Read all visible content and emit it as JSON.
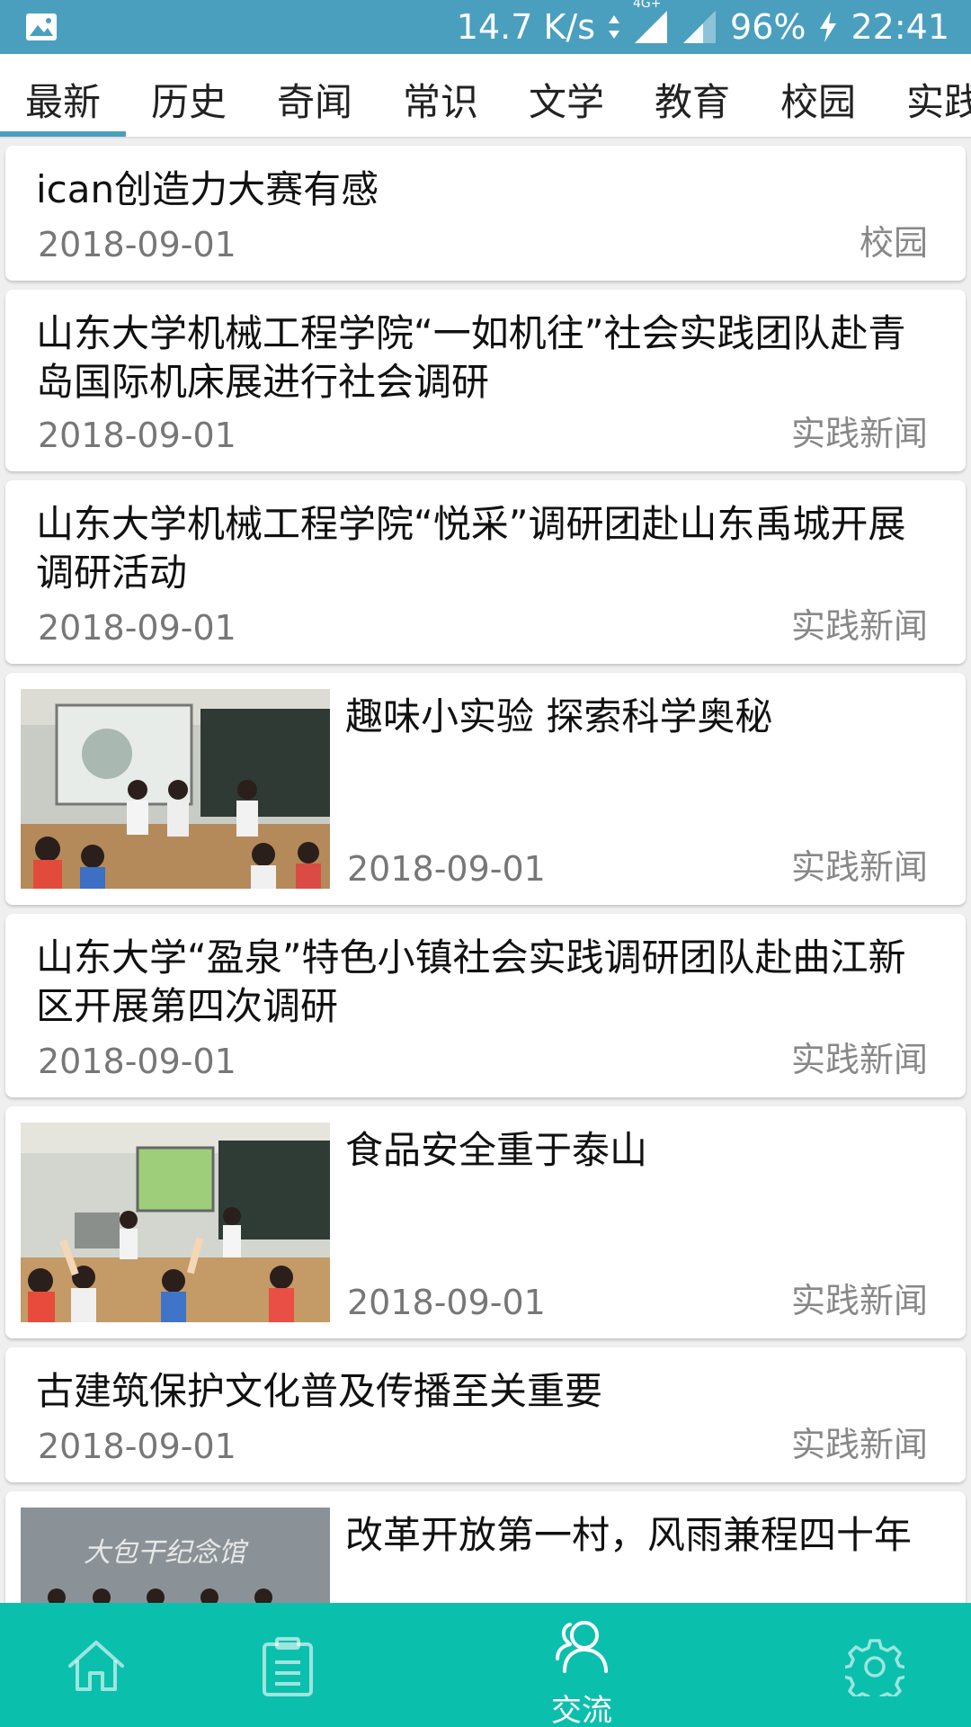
{
  "status_bar": {
    "speed": "14.7 K/s",
    "network_type": "4G+",
    "battery": "96%",
    "time": "22:41",
    "icons": [
      "image-icon",
      "data-arrows-icon",
      "signal-icon",
      "signal-icon-2",
      "charging-bolt-icon"
    ]
  },
  "tabs": [
    "最新",
    "历史",
    "奇闻",
    "常识",
    "文学",
    "教育",
    "校园",
    "实践"
  ],
  "active_tab_index": 0,
  "news": [
    {
      "title": "ican创造力大赛有感",
      "date": "2018-09-01",
      "category": "校园",
      "has_image": false
    },
    {
      "title": "山东大学机械工程学院“一如机往”社会实践团队赴青岛国际机床展进行社会调研",
      "date": "2018-09-01",
      "category": "实践新闻",
      "has_image": false
    },
    {
      "title": "山东大学机械工程学院“悦采”调研团赴山东禹城开展调研活动",
      "date": "2018-09-01",
      "category": "实践新闻",
      "has_image": false
    },
    {
      "title": "趣味小实验 探索科学奥秘",
      "date": "2018-09-01",
      "category": "实践新闻",
      "has_image": true
    },
    {
      "title": "山东大学“盈泉”特色小镇社会实践调研团队赴曲江新区开展第四次调研",
      "date": "2018-09-01",
      "category": "实践新闻",
      "has_image": false
    },
    {
      "title": "食品安全重于泰山",
      "date": "2018-09-01",
      "category": "实践新闻",
      "has_image": true
    },
    {
      "title": "古建筑保护文化普及传播至关重要",
      "date": "2018-09-01",
      "category": "实践新闻",
      "has_image": false
    },
    {
      "title": "改革开放第一村，风雨兼程四十年",
      "date": "",
      "category": "",
      "has_image": true
    }
  ],
  "bottom_nav": [
    {
      "icon": "home-icon",
      "label": ""
    },
    {
      "icon": "clipboard-icon",
      "label": ""
    },
    {
      "icon": "people-icon",
      "label": "交流"
    },
    {
      "icon": "gear-icon",
      "label": ""
    }
  ],
  "colors": {
    "status_bar": "#4a9fbf",
    "tab_indicator": "#4a9fbf",
    "bottom_nav": "#0bbfad"
  }
}
